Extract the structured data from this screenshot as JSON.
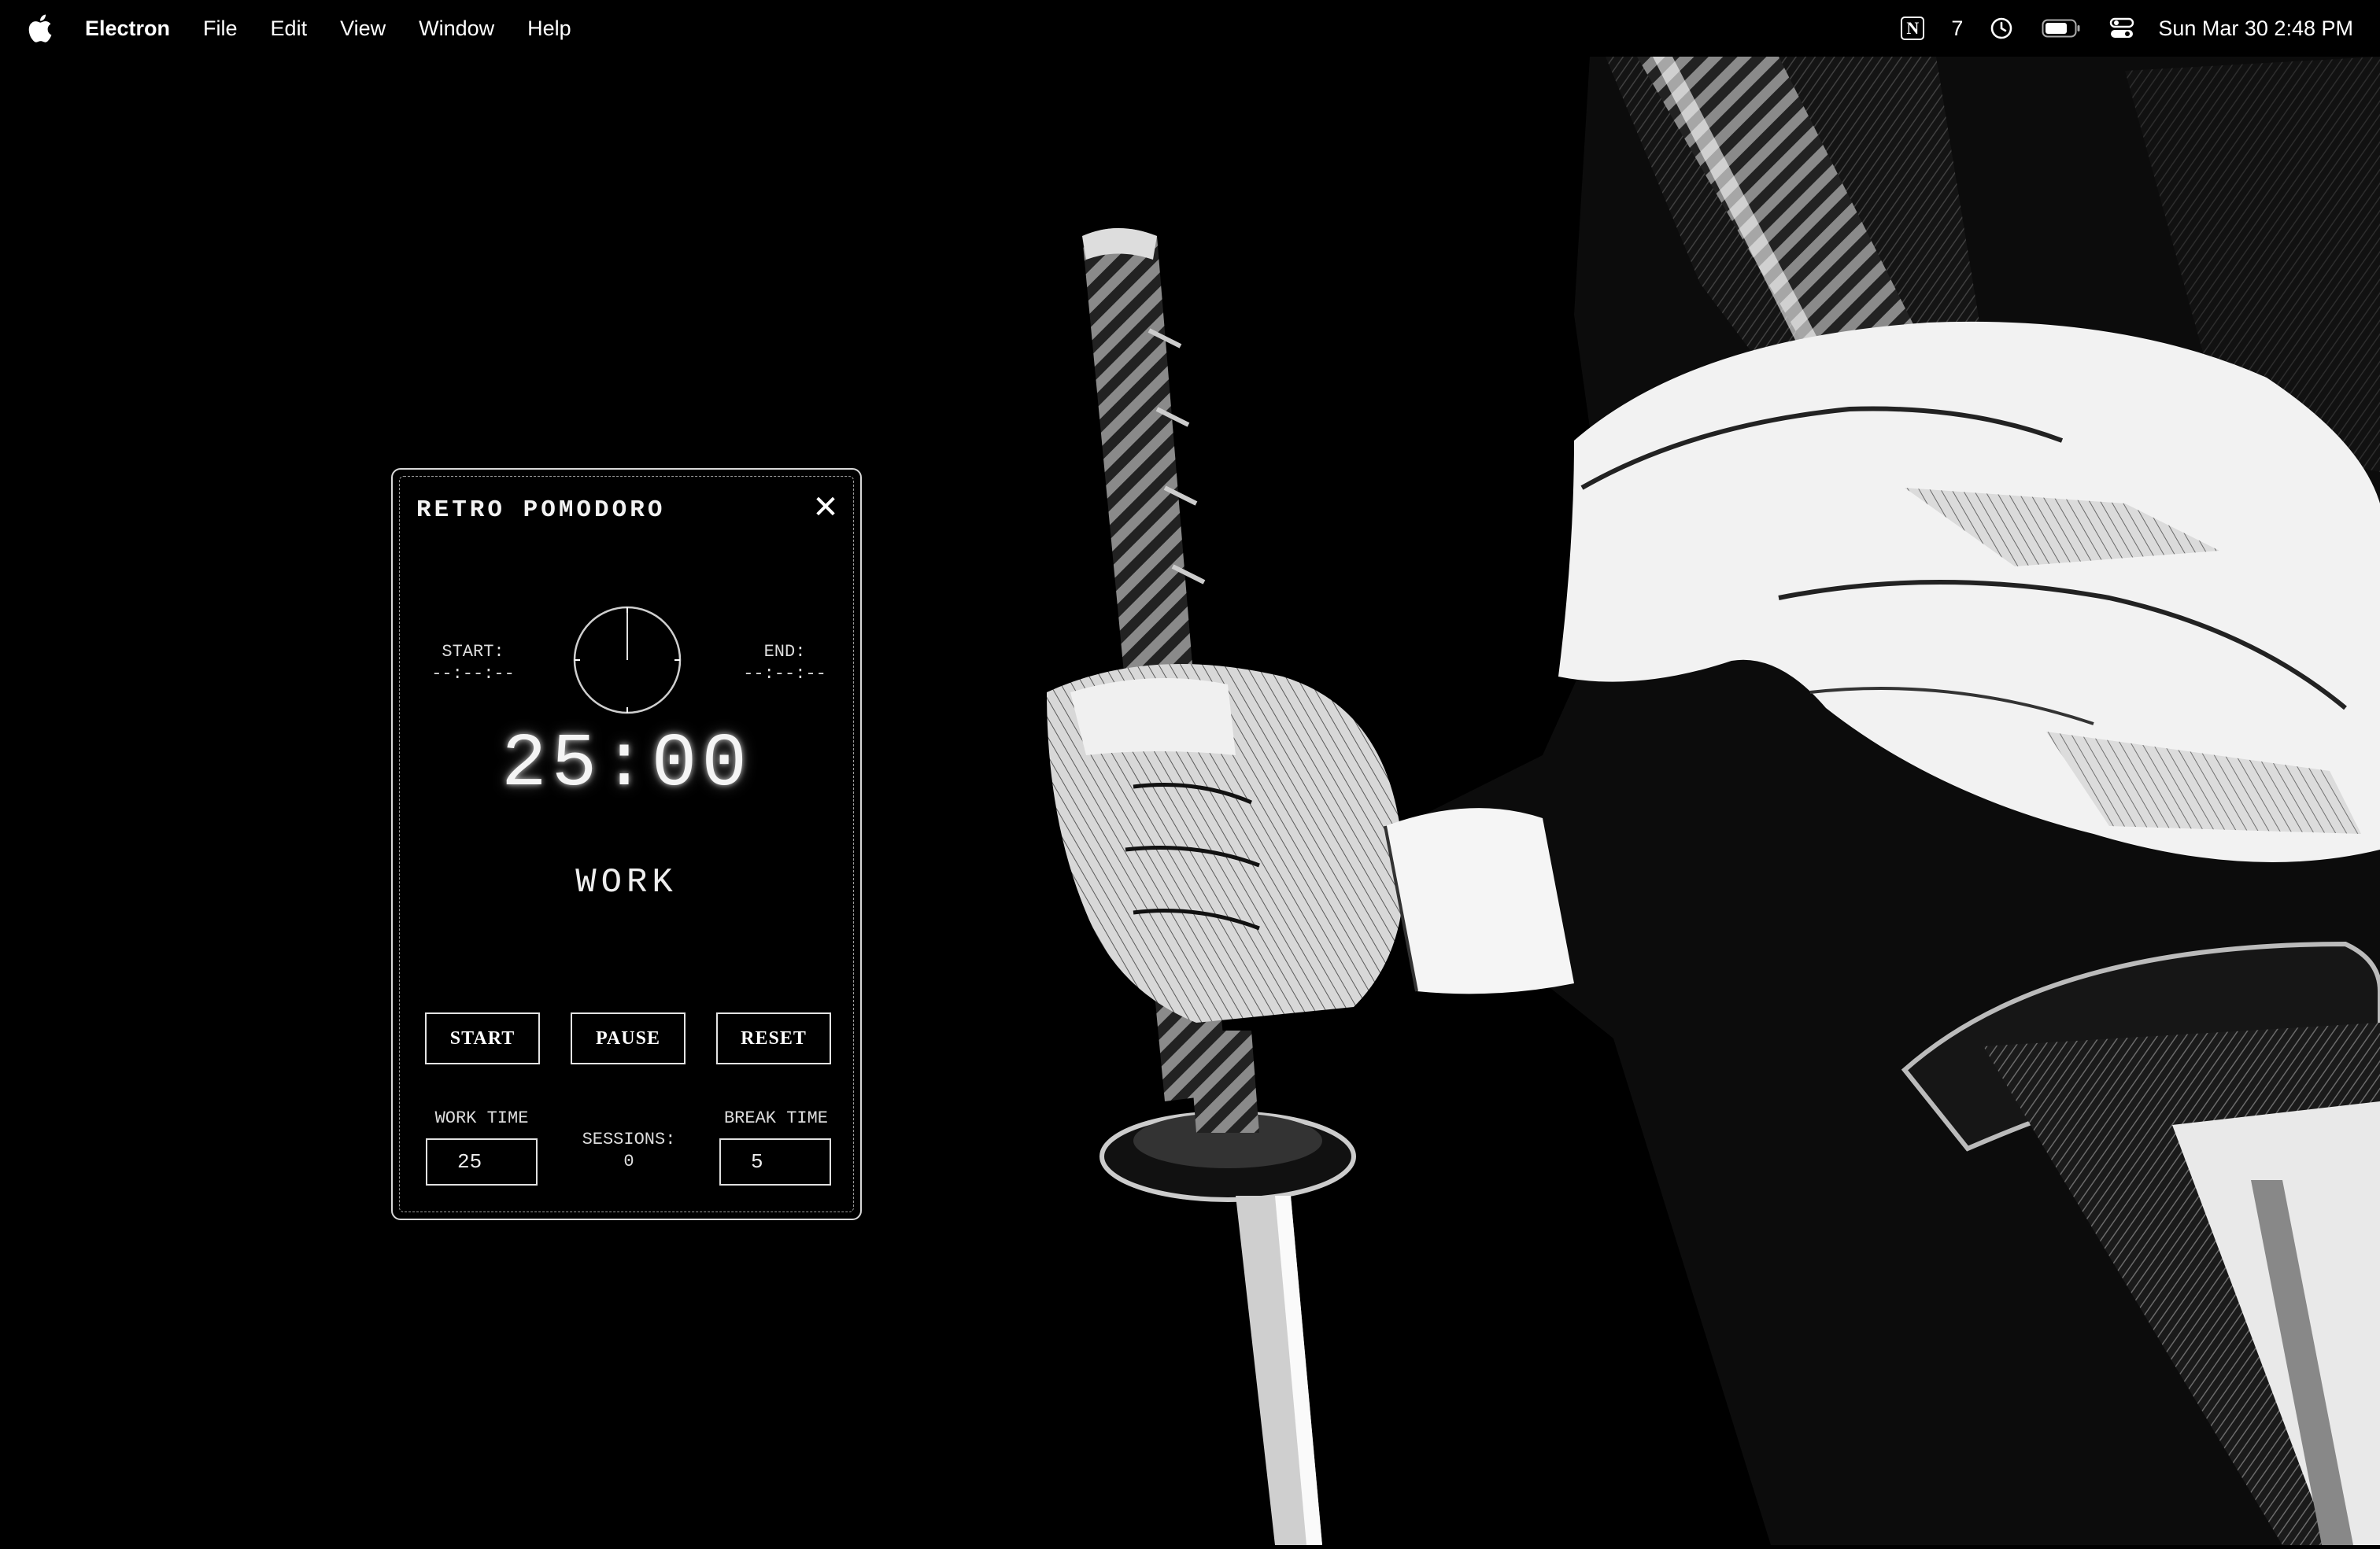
{
  "menubar": {
    "apple_icon": "apple-logo-icon",
    "app_name": "Electron",
    "items": [
      "File",
      "Edit",
      "View",
      "Window",
      "Help"
    ],
    "status": {
      "notion_letter": "N",
      "count": "7",
      "datetime": "Sun Mar 30  2:48 PM"
    }
  },
  "pomodoro": {
    "title": "RETRO POMODORO",
    "close_glyph": "✕",
    "start_label": "START:",
    "start_value": "--:--:--",
    "end_label": "END:",
    "end_value": "--:--:--",
    "timer": "25:00",
    "mode": "WORK",
    "buttons": {
      "start": "START",
      "pause": "PAUSE",
      "reset": "RESET"
    },
    "work_time_label": "WORK TIME",
    "work_time_value": "25",
    "sessions_label": "SESSIONS:",
    "sessions_value": "0",
    "break_time_label": "BREAK TIME",
    "break_time_value": "5"
  },
  "colors": {
    "background": "#000000",
    "foreground": "#ffffff",
    "border": "#d9d9d9"
  }
}
